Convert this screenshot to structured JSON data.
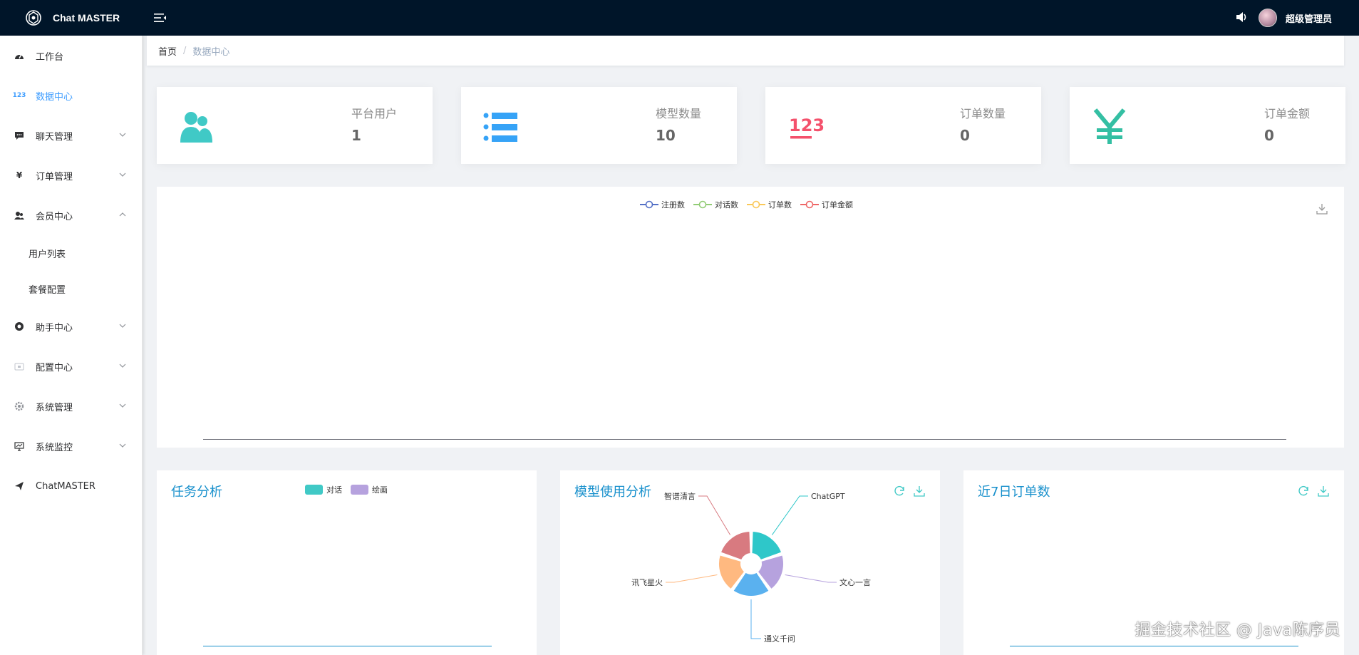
{
  "app": {
    "title": "Chat MASTER"
  },
  "header": {
    "user_name": "超级管理员",
    "volume_icon": "volume-icon",
    "menu_toggle_icon": "menu-fold-icon"
  },
  "sidebar": {
    "items": [
      {
        "label": "工作台",
        "icon": "dashboard-icon"
      },
      {
        "label": "数据中心",
        "icon": "number-icon",
        "active": true
      },
      {
        "label": "聊天管理",
        "icon": "chat-icon",
        "expandable": true
      },
      {
        "label": "订单管理",
        "icon": "yen-icon",
        "expandable": true
      },
      {
        "label": "会员中心",
        "icon": "user-icon",
        "expanded": true
      },
      {
        "label": "助手中心",
        "icon": "help-icon",
        "expandable": true
      },
      {
        "label": "配置中心",
        "icon": "config-icon",
        "expandable": true
      },
      {
        "label": "系统管理",
        "icon": "gear-icon",
        "expandable": true
      },
      {
        "label": "系统监控",
        "icon": "monitor-icon",
        "expandable": true
      },
      {
        "label": "ChatMASTER",
        "icon": "send-icon"
      }
    ],
    "sub_items": [
      {
        "label": "用户列表"
      },
      {
        "label": "套餐配置"
      }
    ]
  },
  "breadcrumb": {
    "home": "首页",
    "separator": "/",
    "current": "数据中心"
  },
  "stats": [
    {
      "label": "平台用户",
      "value": "1",
      "icon": "users-icon",
      "color": "#40c9c6"
    },
    {
      "label": "模型数量",
      "value": "10",
      "icon": "list-icon",
      "color": "#36a3f7"
    },
    {
      "label": "订单数量",
      "value": "0",
      "icon": "number-123-icon",
      "color": "#f4516c"
    },
    {
      "label": "订单金额",
      "value": "0",
      "icon": "yen-icon",
      "color": "#34bfa3"
    }
  ],
  "main_chart": {
    "legend": [
      {
        "name": "注册数",
        "color": "#5470c6"
      },
      {
        "name": "对话数",
        "color": "#91cc75"
      },
      {
        "name": "订单数",
        "color": "#fac858"
      },
      {
        "name": "订单金额",
        "color": "#ee6666"
      }
    ]
  },
  "task_panel": {
    "title": "任务分析",
    "legend": [
      {
        "name": "对话",
        "color": "#40c9c6"
      },
      {
        "name": "绘画",
        "color": "#b6a2de"
      }
    ]
  },
  "model_panel": {
    "title": "模型使用分析",
    "slices": [
      {
        "name": "ChatGPT",
        "color": "#2ec7c9"
      },
      {
        "name": "文心一言",
        "color": "#b6a2de"
      },
      {
        "name": "通义千问",
        "color": "#5ab1ef"
      },
      {
        "name": "讯飞星火",
        "color": "#ffb980"
      },
      {
        "name": "智谱清言",
        "color": "#d87a80"
      }
    ]
  },
  "order_panel": {
    "title": "近7日订单数"
  },
  "watermark": "掘金技术社区 @ Java陈序员"
}
